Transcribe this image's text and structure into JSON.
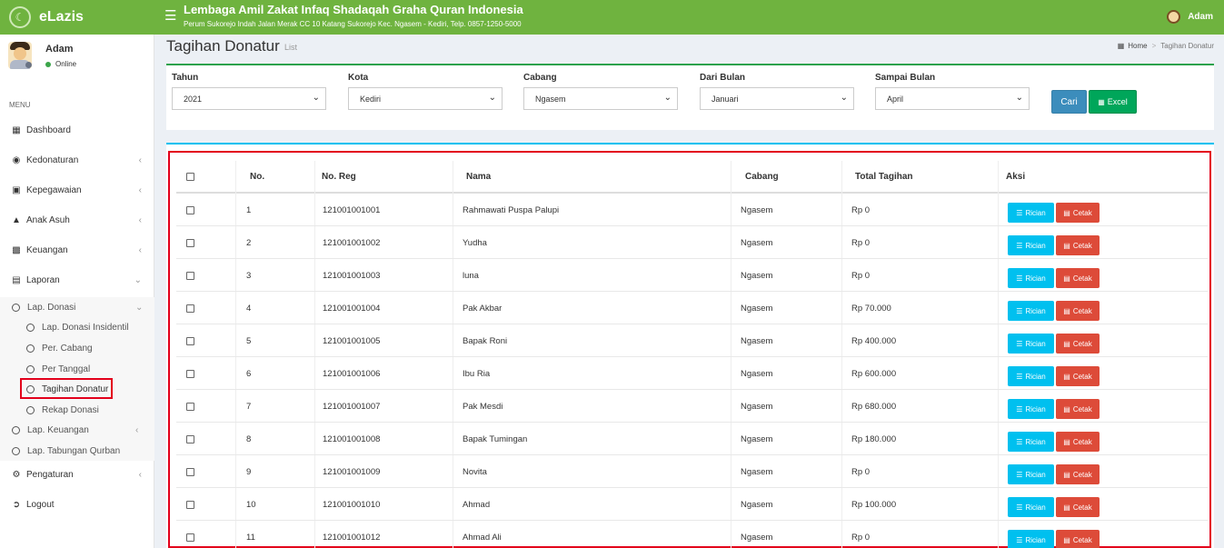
{
  "app": {
    "name": "eLazis",
    "logo_icon": "mosque-icon"
  },
  "header": {
    "org_name": "Lembaga Amil Zakat Infaq Shadaqah Graha Quran Indonesia",
    "org_address": "Perum Sukorejo Indah Jalan Merak CC 10 Katang Sukorejo Kec. Ngasem - Kediri, Telp. 0857-1250-5000",
    "user_name": "Adam",
    "menu_icon": "hamburger-icon"
  },
  "sidebar": {
    "user_name": "Adam",
    "status": "Online",
    "menu_header": "MENU",
    "items": [
      {
        "label": "Dashboard",
        "icon": "grid-icon"
      },
      {
        "label": "Kedonaturan",
        "icon": "users-icon"
      },
      {
        "label": "Kepegawaian",
        "icon": "briefcase-icon"
      },
      {
        "label": "Anak Asuh",
        "icon": "graduation-cap-icon"
      },
      {
        "label": "Keuangan",
        "icon": "money-icon"
      },
      {
        "label": "Laporan",
        "icon": "file-icon"
      }
    ],
    "laporan_sub": [
      {
        "label": "Lap. Donasi"
      },
      {
        "label": "Lap. Donasi Insidentil"
      },
      {
        "label": "Per. Cabang"
      },
      {
        "label": "Per Tanggal"
      },
      {
        "label": "Tagihan Donatur"
      },
      {
        "label": "Rekap Donasi"
      },
      {
        "label": "Lap. Keuangan"
      },
      {
        "label": "Lap. Tabungan Qurban"
      }
    ],
    "bottom_items": [
      {
        "label": "Pengaturan",
        "icon": "gear-icon"
      },
      {
        "label": "Logout",
        "icon": "sign-out-icon"
      }
    ],
    "active_item": "Tagihan Donatur",
    "highlight_color": "#e3001b"
  },
  "page": {
    "title": "Tagihan Donatur",
    "subtitle": "List",
    "breadcrumb": {
      "home": "Home",
      "current": "Tagihan Donatur"
    }
  },
  "filters": {
    "tahun": {
      "label": "Tahun",
      "value": "2021"
    },
    "kota": {
      "label": "Kota",
      "value": "Kediri"
    },
    "cabang": {
      "label": "Cabang",
      "value": "Ngasem"
    },
    "dari_bulan": {
      "label": "Dari Bulan",
      "value": "Januari"
    },
    "sampai_bulan": {
      "label": "Sampai Bulan",
      "value": "April"
    },
    "cari_label": "Cari",
    "excel_label": "Excel"
  },
  "table": {
    "headers": {
      "no": "No.",
      "no_reg": "No. Reg",
      "nama": "Nama",
      "cabang": "Cabang",
      "total": "Total Tagihan",
      "aksi": "Aksi"
    },
    "rincian_label": "Rician",
    "cetak_label": "Cetak",
    "rows": [
      {
        "no": "1",
        "no_reg": "121001001001",
        "nama": "Rahmawati Puspa Palupi",
        "cabang": "Ngasem",
        "total": "Rp 0"
      },
      {
        "no": "2",
        "no_reg": "121001001002",
        "nama": "Yudha",
        "cabang": "Ngasem",
        "total": "Rp 0"
      },
      {
        "no": "3",
        "no_reg": "121001001003",
        "nama": "luna",
        "cabang": "Ngasem",
        "total": "Rp 0"
      },
      {
        "no": "4",
        "no_reg": "121001001004",
        "nama": "Pak Akbar",
        "cabang": "Ngasem",
        "total": "Rp 70.000"
      },
      {
        "no": "5",
        "no_reg": "121001001005",
        "nama": "Bapak Roni",
        "cabang": "Ngasem",
        "total": "Rp 400.000"
      },
      {
        "no": "6",
        "no_reg": "121001001006",
        "nama": "Ibu Ria",
        "cabang": "Ngasem",
        "total": "Rp 600.000"
      },
      {
        "no": "7",
        "no_reg": "121001001007",
        "nama": "Pak Mesdi",
        "cabang": "Ngasem",
        "total": "Rp 680.000"
      },
      {
        "no": "8",
        "no_reg": "121001001008",
        "nama": "Bapak Tumingan",
        "cabang": "Ngasem",
        "total": "Rp 180.000"
      },
      {
        "no": "9",
        "no_reg": "121001001009",
        "nama": "Novita",
        "cabang": "Ngasem",
        "total": "Rp 0"
      },
      {
        "no": "10",
        "no_reg": "121001001010",
        "nama": "Ahmad",
        "cabang": "Ngasem",
        "total": "Rp 100.000"
      },
      {
        "no": "11",
        "no_reg": "121001001012",
        "nama": "Ahmad Ali",
        "cabang": "Ngasem",
        "total": "Rp 0"
      }
    ]
  },
  "colors": {
    "topbar": "#6fb33f",
    "filter_accent": "#2ca24c",
    "table_accent": "#00c0ef",
    "highlight": "#e3001b"
  }
}
